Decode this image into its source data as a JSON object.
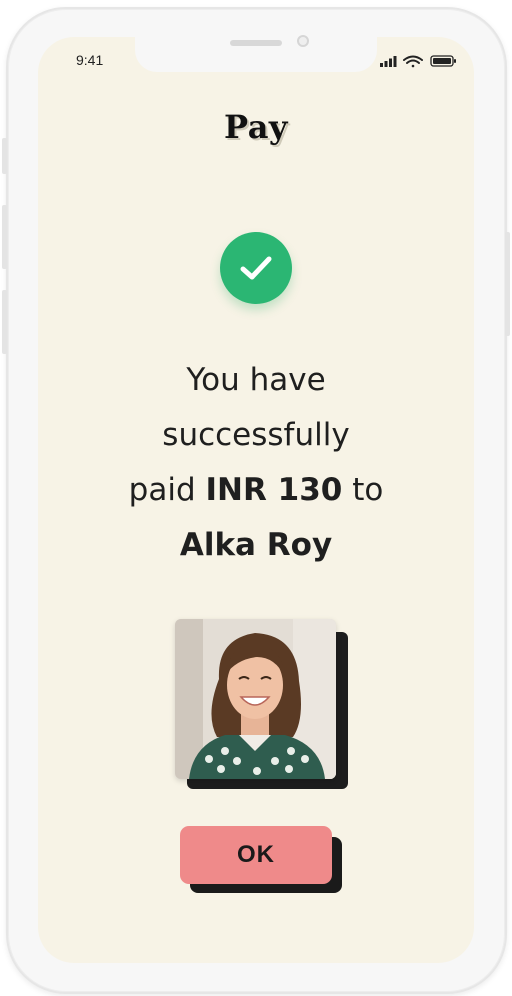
{
  "status_bar": {
    "time": "9:41",
    "signal_icon": "signal-bars-icon",
    "wifi_icon": "wifi-icon",
    "battery_icon": "battery-icon"
  },
  "header": {
    "title": "Pay"
  },
  "confirmation": {
    "icon": "checkmark-circle-icon",
    "line1": "You have",
    "line2": "successfully",
    "line3_prefix": "paid ",
    "amount": "INR 130",
    "line3_suffix": " to",
    "recipient": "Alka Roy"
  },
  "recipient_photo": {
    "alt": "Alka Roy"
  },
  "actions": {
    "ok_label": "OK"
  },
  "colors": {
    "background": "#f7f3e6",
    "success": "#2bb673",
    "button": "#ef8a8a"
  }
}
